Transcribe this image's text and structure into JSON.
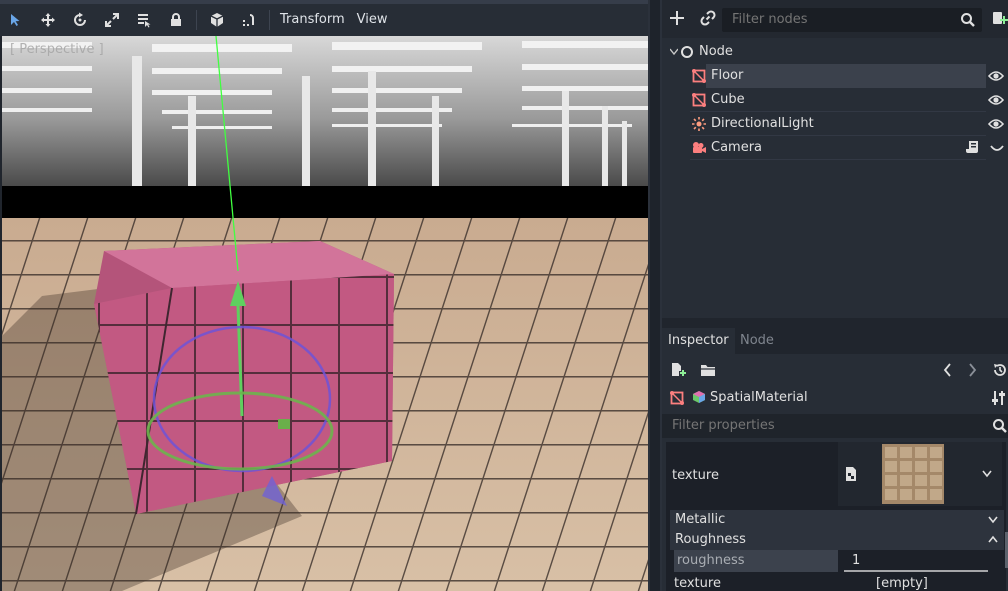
{
  "viewport": {
    "toolbar": {
      "tools": [
        "select-icon",
        "move-icon",
        "rotate-icon",
        "scale-icon",
        "list-select-icon",
        "lock-icon",
        "cube-view-icon",
        "snap-icon"
      ],
      "menus": [
        "Transform",
        "View"
      ]
    },
    "perspective_label": "[ Perspective ]"
  },
  "scene": {
    "filter_placeholder": "Filter nodes",
    "tree": [
      {
        "name": "Node",
        "icon": "node-circle-icon",
        "indent": 0
      },
      {
        "name": "Floor",
        "icon": "mesh-icon",
        "indent": 1,
        "selected": true,
        "visible_toggle": "eye-icon"
      },
      {
        "name": "Cube",
        "icon": "mesh-icon",
        "indent": 1,
        "visible_toggle": "eye-icon"
      },
      {
        "name": "DirectionalLight",
        "icon": "light-icon",
        "indent": 1,
        "visible_toggle": "eye-icon"
      },
      {
        "name": "Camera",
        "icon": "camera-icon",
        "indent": 1,
        "extra": "script-icon"
      }
    ]
  },
  "inspector": {
    "tabs": [
      "Inspector",
      "Node"
    ],
    "resource_type": "SpatialMaterial",
    "filter_placeholder": "Filter properties",
    "albedo_texture_label": "texture",
    "section_metallic": "Metallic",
    "section_roughness": "Roughness",
    "roughness_label": "roughness",
    "roughness_value": "1",
    "texture2_label": "texture",
    "texture2_value": "[empty]"
  },
  "colors": {
    "accent": "#6aa6e8",
    "mesh_icon": "#fc7f7f",
    "light_icon": "#fc9c7f",
    "selected_row": "#3b414c"
  }
}
